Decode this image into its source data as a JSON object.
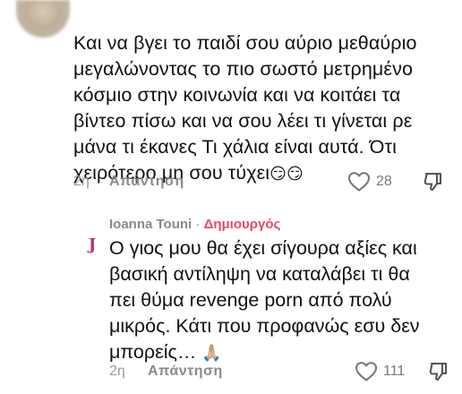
{
  "comments": [
    {
      "text": "Και να βγει το παιδί σου αύριο μεθαύριο\nμεγαλώνοντας το πιο σωστό μετρημένο\nκόσμιο στην κοινωνία και να κοιτάει τα\nβίντεο πίσω και να σου λέει τι γίνεται ρε\nμάνα τι έκανες Τι χάλια είναι αυτά. Ότι\nχειρότερο μη σου τύχει",
      "emoji": "😏😏",
      "age": "2η",
      "reply_label": "Απάντηση",
      "likes": "28",
      "avatar": "blurred-profile-photo",
      "liked": false
    },
    {
      "author": "Ioanna Touni",
      "separator": "·",
      "badge": "Δημιουργός",
      "avatar_letter": "J",
      "text": "Ο γιος μου θα έχει σίγουρα αξίες και\nβασική αντίληψη να καταλάβει τι θα\nπει θύμα revenge porn από πολύ\nμικρός. Κάτι που προφανώς εσυ δεν\nμπορείς…",
      "emoji": "🙏🏼",
      "age": "2η",
      "reply_label": "Απάντηση",
      "likes": "111",
      "liked": false
    }
  ],
  "colors": {
    "badge": "#e8486b",
    "muted": "#8a8a8a",
    "avatar_letter": "#b2327d",
    "text": "#111111"
  },
  "icons": {
    "like": "heart-outline-icon",
    "dislike": "thumbs-down-outline-icon"
  }
}
